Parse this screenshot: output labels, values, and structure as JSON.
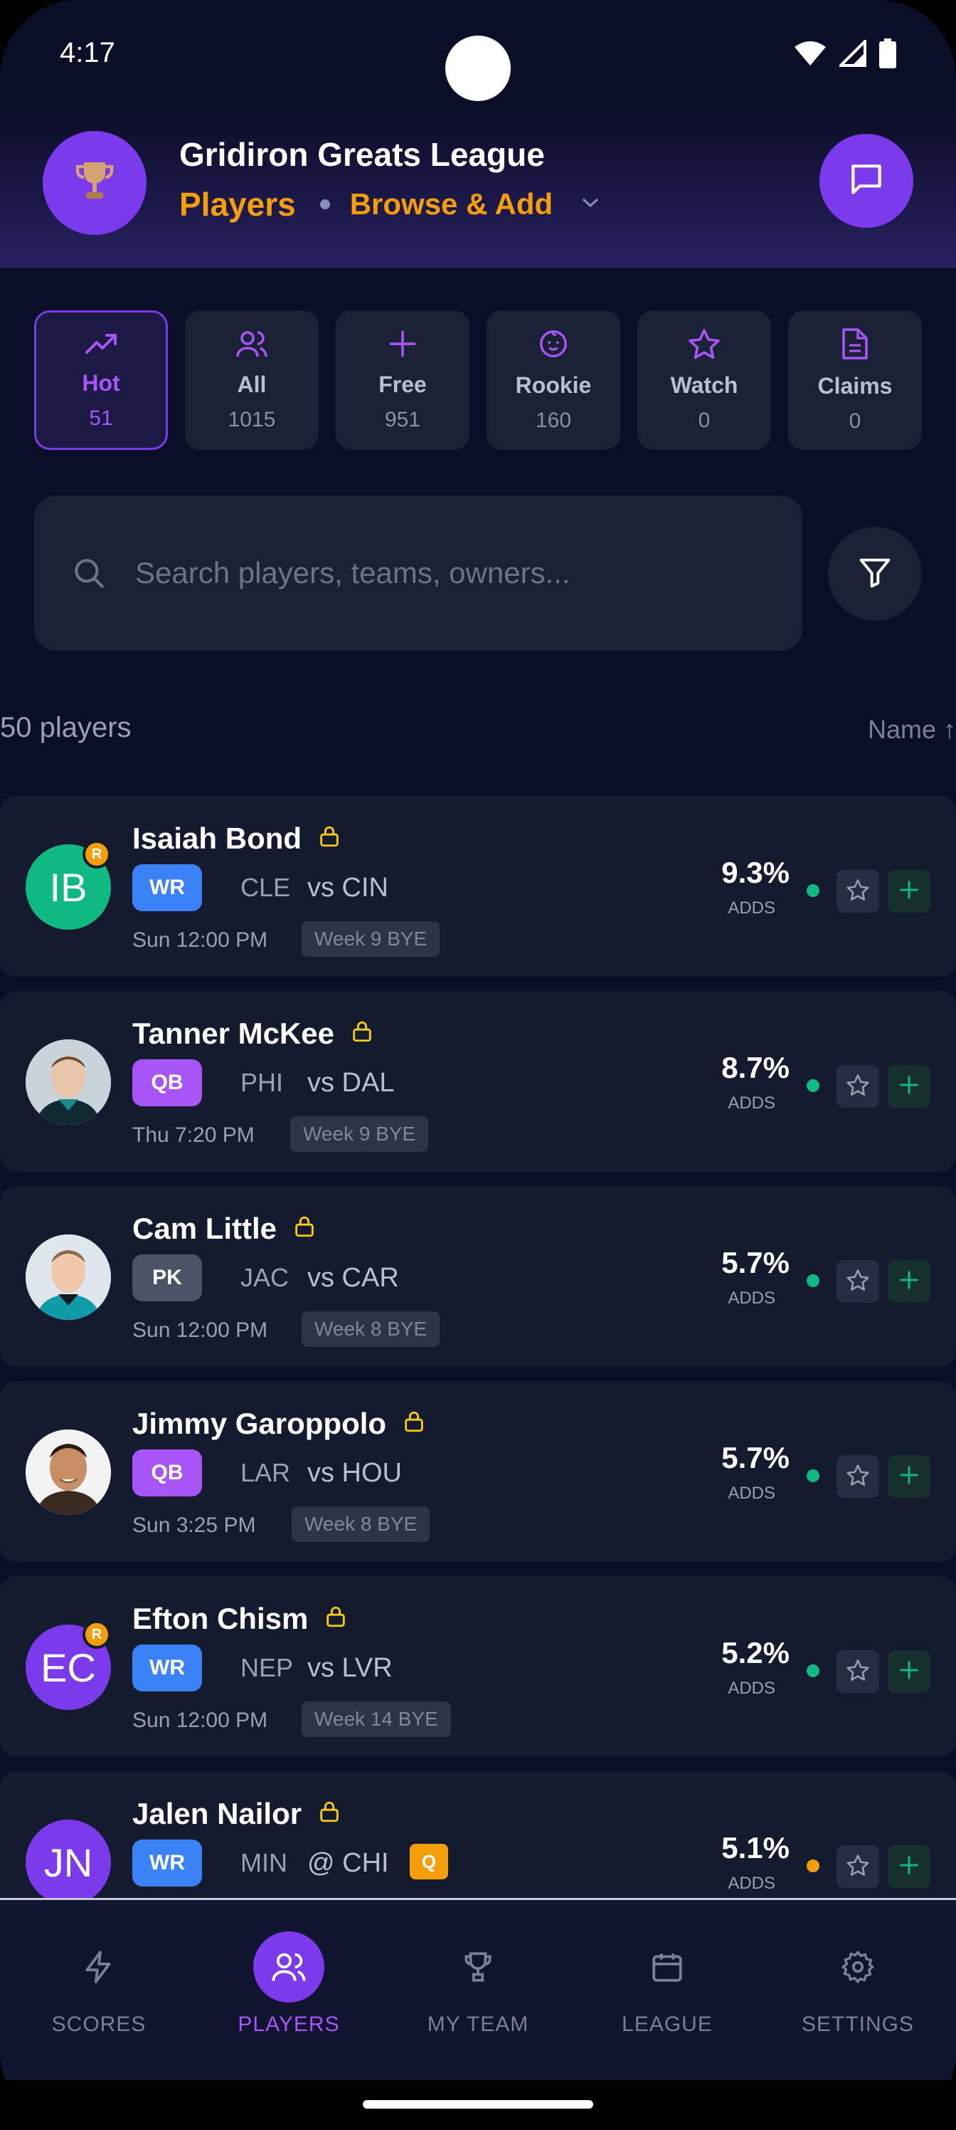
{
  "status_bar": {
    "time": "4:17"
  },
  "header": {
    "league_name": "Gridiron Greats League",
    "section": "Players",
    "subsection": "Browse & Add"
  },
  "chips": [
    {
      "label": "Hot",
      "count": "51",
      "icon": "trending-up-icon",
      "active": true
    },
    {
      "label": "All",
      "count": "1015",
      "icon": "users-icon",
      "active": false
    },
    {
      "label": "Free",
      "count": "951",
      "icon": "plus-icon",
      "active": false
    },
    {
      "label": "Rookie",
      "count": "160",
      "icon": "baby-icon",
      "active": false
    },
    {
      "label": "Watch",
      "count": "0",
      "icon": "star-icon",
      "active": false
    },
    {
      "label": "Claims",
      "count": "0",
      "icon": "document-icon",
      "active": false
    }
  ],
  "search": {
    "placeholder": "Search players, teams, owners..."
  },
  "list_header": {
    "count": "50 players",
    "sort": "Name ↑"
  },
  "players": [
    {
      "name": "Isaiah Bond",
      "initials": "IB",
      "avatar_color": "#10b981",
      "rookie": true,
      "rookie_label": "R",
      "position": "WR",
      "pos_color": "#3b82f6",
      "team": "CLE",
      "opponent": "vs CIN",
      "game_time": "Sun 12:00 PM",
      "bye": "Week 9 BYE",
      "add_pct": "9.3%",
      "adds_label": "ADDS",
      "trend_color": "#10b981"
    },
    {
      "name": "Tanner McKee",
      "initials": "",
      "avatar_color": "#c9d3da",
      "rookie": false,
      "position": "QB",
      "pos_color": "#a855f7",
      "team": "PHI",
      "opponent": "vs DAL",
      "game_time": "Thu 7:20 PM",
      "bye": "Week 9 BYE",
      "add_pct": "8.7%",
      "adds_label": "ADDS",
      "trend_color": "#10b981"
    },
    {
      "name": "Cam Little",
      "initials": "",
      "avatar_color": "#dfe6ec",
      "rookie": false,
      "position": "PK",
      "pos_color": "#4b5366",
      "team": "JAC",
      "opponent": "vs CAR",
      "game_time": "Sun 12:00 PM",
      "bye": "Week 8 BYE",
      "add_pct": "5.7%",
      "adds_label": "ADDS",
      "trend_color": "#10b981"
    },
    {
      "name": "Jimmy Garoppolo",
      "initials": "",
      "avatar_color": "#f3f3f3",
      "rookie": false,
      "position": "QB",
      "pos_color": "#a855f7",
      "team": "LAR",
      "opponent": "vs HOU",
      "game_time": "Sun 3:25 PM",
      "bye": "Week 8 BYE",
      "add_pct": "5.7%",
      "adds_label": "ADDS",
      "trend_color": "#10b981"
    },
    {
      "name": "Efton Chism",
      "initials": "EC",
      "avatar_color": "#7c3aed",
      "rookie": true,
      "rookie_label": "R",
      "position": "WR",
      "pos_color": "#3b82f6",
      "team": "NEP",
      "opponent": "vs LVR",
      "game_time": "Sun 12:00 PM",
      "bye": "Week 14 BYE",
      "add_pct": "5.2%",
      "adds_label": "ADDS",
      "trend_color": "#10b981"
    },
    {
      "name": "Jalen Nailor",
      "initials": "JN",
      "avatar_color": "#7c3aed",
      "rookie": false,
      "position": "WR",
      "pos_color": "#3b82f6",
      "team": "MIN",
      "opponent": "@ CHI",
      "injury": "Q",
      "game_time": "",
      "bye": "",
      "add_pct": "5.1%",
      "adds_label": "ADDS",
      "trend_color": "#f59e0b"
    }
  ],
  "nav": [
    {
      "label": "SCORES",
      "icon": "lightning-icon",
      "active": false
    },
    {
      "label": "PLAYERS",
      "icon": "users-icon",
      "active": true
    },
    {
      "label": "MY TEAM",
      "icon": "trophy-icon",
      "active": false
    },
    {
      "label": "LEAGUE",
      "icon": "calendar-icon",
      "active": false
    },
    {
      "label": "SETTINGS",
      "icon": "gear-icon",
      "active": false
    }
  ],
  "colors": {
    "accent": "#7c3aed",
    "highlight": "#f59e0b",
    "background": "#0b0e27",
    "card": "#141b2e"
  }
}
